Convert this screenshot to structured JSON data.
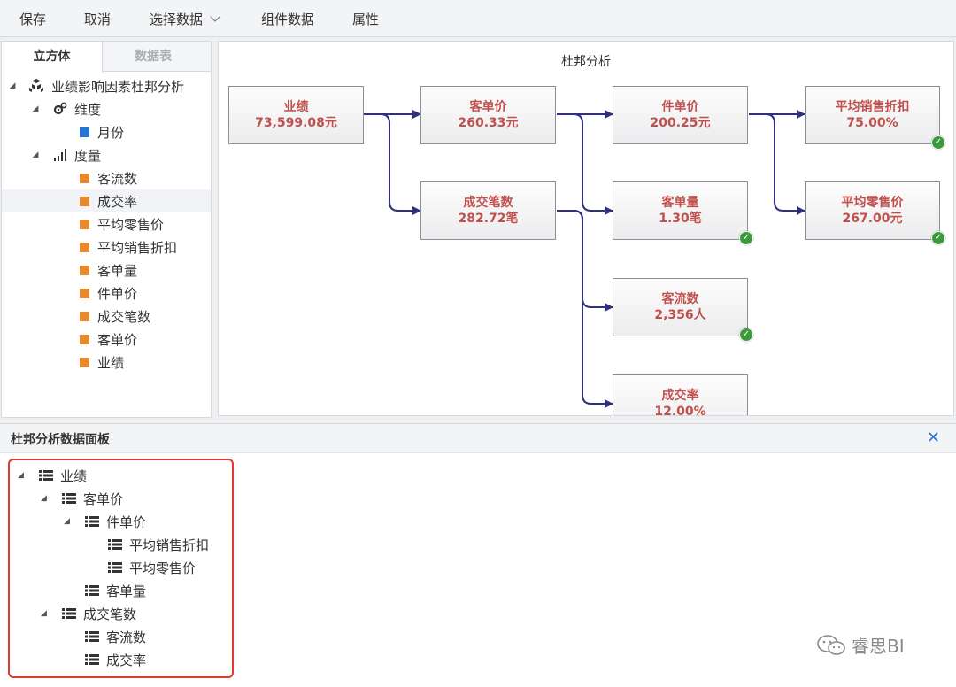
{
  "toolbar": {
    "save": "保存",
    "cancel": "取消",
    "select_data": "选择数据",
    "component_data": "组件数据",
    "properties": "属性"
  },
  "left_panel": {
    "tabs": [
      "立方体",
      "数据表"
    ],
    "root": "业绩影响因素杜邦分析",
    "dimension_group": "维度",
    "dimensions": [
      "月份"
    ],
    "measure_group": "度量",
    "measures": [
      "客流数",
      "成交率",
      "平均零售价",
      "平均销售折扣",
      "客单量",
      "件单价",
      "成交笔数",
      "客单价",
      "业绩"
    ]
  },
  "canvas": {
    "title": "杜邦分析",
    "nodes": {
      "performance": {
        "label": "业绩",
        "value": "73,599.08元"
      },
      "avg_ticket": {
        "label": "客单价",
        "value": "260.33元"
      },
      "transactions": {
        "label": "成交笔数",
        "value": "282.72笔"
      },
      "unit_price": {
        "label": "件单价",
        "value": "200.25元"
      },
      "items_per_ticket": {
        "label": "客单量",
        "value": "1.30笔"
      },
      "traffic": {
        "label": "客流数",
        "value": "2,356人"
      },
      "conversion": {
        "label": "成交率",
        "value": "12.00%"
      },
      "avg_discount": {
        "label": "平均销售折扣",
        "value": "75.00%"
      },
      "avg_retail": {
        "label": "平均零售价",
        "value": "267.00元"
      }
    }
  },
  "bottom_panel": {
    "title": "杜邦分析数据面板",
    "tree": {
      "root": "业绩",
      "avg_ticket": "客单价",
      "unit_price": "件单价",
      "avg_discount": "平均销售折扣",
      "avg_retail": "平均零售价",
      "items_per_ticket": "客单量",
      "transactions": "成交笔数",
      "traffic": "客流数",
      "conversion": "成交率"
    }
  },
  "watermark": "睿思BI",
  "colors": {
    "node_text": "#c0504d",
    "edge": "#2f2f7e",
    "check": "#3b9a3b",
    "highlight_box": "#e0392f",
    "accent": "#2a74d6"
  }
}
